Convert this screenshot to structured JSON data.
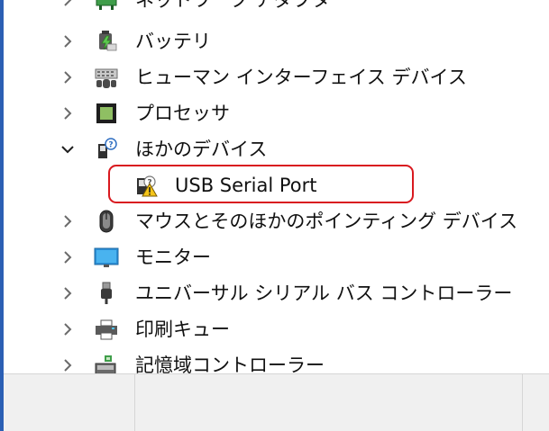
{
  "device_tree": {
    "items": [
      {
        "label": "ネットワーク アダプター",
        "icon": "network-adapter-icon",
        "expanded": false
      },
      {
        "label": "バッテリ",
        "icon": "battery-icon",
        "expanded": false
      },
      {
        "label": "ヒューマン インターフェイス デバイス",
        "icon": "hid-icon",
        "expanded": false
      },
      {
        "label": "プロセッサ",
        "icon": "processor-icon",
        "expanded": false
      },
      {
        "label": "ほかのデバイス",
        "icon": "unknown-device-icon",
        "expanded": true,
        "children": [
          {
            "label": "USB Serial Port",
            "icon": "warning-device-icon",
            "highlighted": true
          }
        ]
      },
      {
        "label": "マウスとそのほかのポインティング デバイス",
        "icon": "mouse-icon",
        "expanded": false
      },
      {
        "label": "モニター",
        "icon": "monitor-icon",
        "expanded": false
      },
      {
        "label": "ユニバーサル シリアル バス コントローラー",
        "icon": "usb-plug-icon",
        "expanded": false
      },
      {
        "label": "印刷キュー",
        "icon": "printer-icon",
        "expanded": false
      },
      {
        "label": "記憶域コントローラー",
        "icon": "storage-controller-icon",
        "expanded": false
      }
    ]
  },
  "colors": {
    "highlight_border": "#d9191f",
    "window_border": "#2b5fb4",
    "statusbar_bg": "#f0f0f0"
  }
}
